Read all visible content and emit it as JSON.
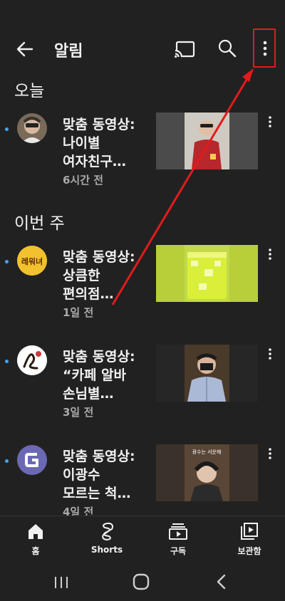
{
  "header": {
    "title": "알림",
    "back_icon": "arrow-left-icon",
    "cast_icon": "cast-icon",
    "search_icon": "search-icon",
    "menu_icon": "more-vertical-icon"
  },
  "sections": {
    "today": "오늘",
    "this_week": "이번 주"
  },
  "notifications": [
    {
      "title": "맞춤 동영상:\n나이별\n여자친구…",
      "time": "6시간 전",
      "avatar": "person-avatar",
      "unread": true
    },
    {
      "title": "맞춤 동영상:\n상큼한\n편의점…",
      "time": "1일 전",
      "avatar": "channel-logo-avatar",
      "avatar_text": "레워녀",
      "unread": true
    },
    {
      "title": "맞춤 동영상:\n“카페 알바\n손님별…",
      "time": "3일 전",
      "avatar": "drawing-avatar",
      "unread": true
    },
    {
      "title": "맞춤 동영상:\n이광수\n모르는 척…",
      "time": "4일 전",
      "avatar": "letter-g-avatar",
      "unread": true
    }
  ],
  "thumbnails": {
    "thumb4_caption": "광수는 서운해"
  },
  "bottom_nav": {
    "home": "홈",
    "shorts": "Shorts",
    "subscriptions": "구독",
    "library": "보관함"
  },
  "colors": {
    "background": "#212121",
    "unread_dot": "#3ea6ff",
    "annotation": "#e21b1b"
  }
}
